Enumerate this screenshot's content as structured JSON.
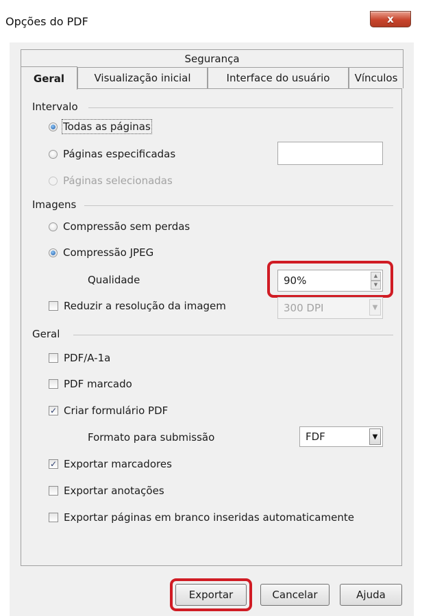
{
  "window": {
    "title": "Opções do PDF",
    "close_glyph": "x"
  },
  "tabs": {
    "row1": [
      {
        "label": "Segurança"
      }
    ],
    "row2": [
      {
        "label": "Geral",
        "active": true
      },
      {
        "label": "Visualização inicial"
      },
      {
        "label": "Interface do usuário"
      },
      {
        "label": "Vínculos"
      }
    ]
  },
  "intervalo": {
    "label": "Intervalo",
    "todas": "Todas as páginas",
    "especificadas": "Páginas especificadas",
    "especificadas_value": "",
    "selecionadas": "Páginas selecionadas",
    "selected": "todas"
  },
  "imagens": {
    "label": "Imagens",
    "sem_perdas": "Compressão sem perdas",
    "jpeg": "Compressão JPEG",
    "selected": "jpeg",
    "qualidade_label": "Qualidade",
    "qualidade_value": "90%",
    "reduzir_label": "Reduzir a resolução da imagem",
    "reduzir_checked": false,
    "dpi_value": "300 DPI"
  },
  "geral": {
    "label": "Geral",
    "pdfa": {
      "label": "PDF/A-1a",
      "checked": false
    },
    "marcado": {
      "label": "PDF marcado",
      "checked": false
    },
    "formulario": {
      "label": "Criar formulário PDF",
      "checked": true
    },
    "formato_label": "Formato para submissão",
    "formato_value": "FDF",
    "marcadores": {
      "label": "Exportar marcadores",
      "checked": true
    },
    "anotacoes": {
      "label": "Exportar anotações",
      "checked": false
    },
    "branco": {
      "label": "Exportar páginas em branco inseridas automaticamente",
      "checked": false
    }
  },
  "buttons": {
    "exportar": "Exportar",
    "cancelar": "Cancelar",
    "ajuda": "Ajuda"
  },
  "icons": {
    "check": "✓",
    "spin_up": "▲",
    "spin_down": "▼",
    "dropdown": "▼"
  },
  "colors": {
    "highlight": "#d01c24",
    "close_button": "#c8452d",
    "radio_dot": "#1e5aa8"
  }
}
